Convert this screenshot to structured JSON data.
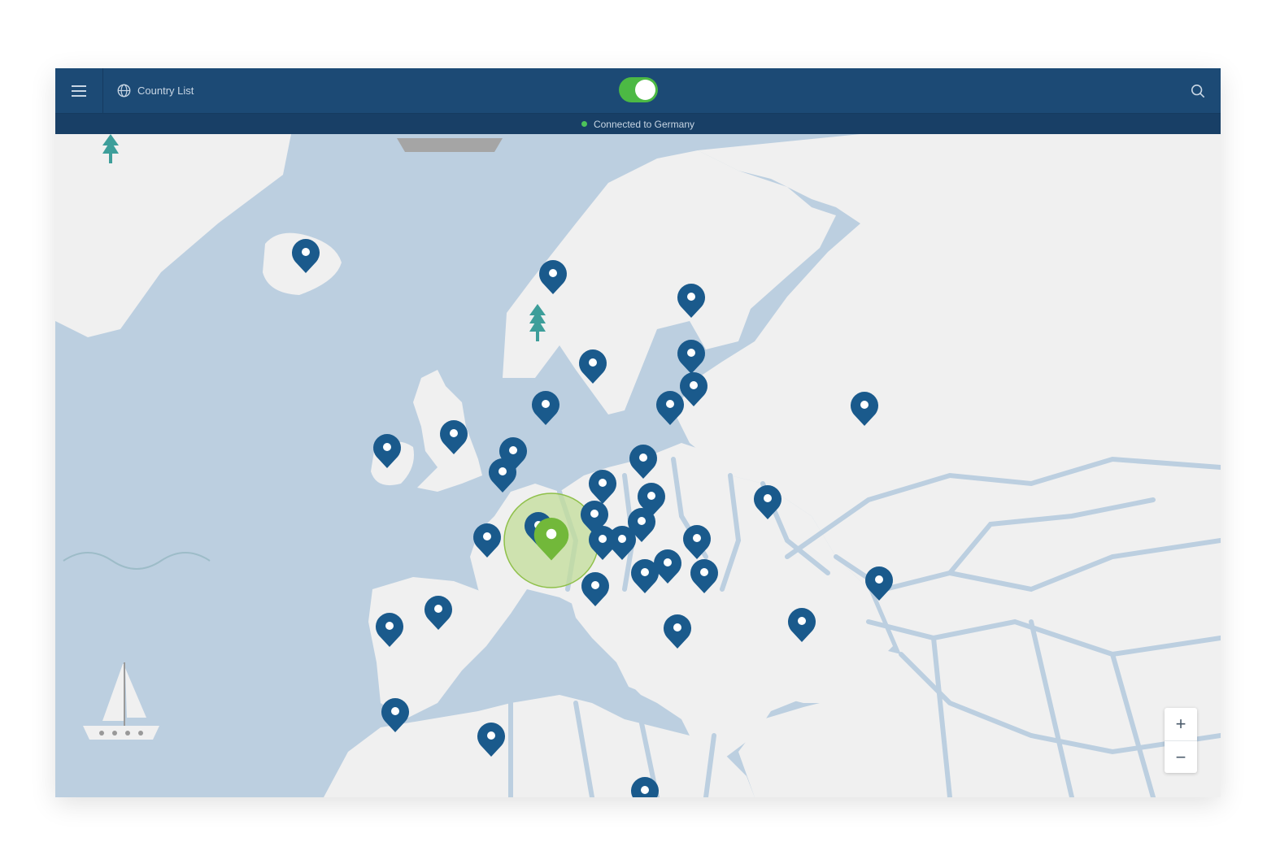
{
  "header": {
    "menu_icon": "hamburger-menu-icon",
    "country_list_label": "Country List",
    "country_list_icon": "globe-icon",
    "search_icon": "search-icon",
    "vpn_toggle_on": true
  },
  "status": {
    "text": "Connected to Germany",
    "dot_color": "#4cc35a"
  },
  "map": {
    "active_country": "Germany",
    "colors": {
      "water": "#bccfe0",
      "land": "#f0f0f0",
      "pin": "#1a5a8c",
      "active_pin": "#72b83a"
    }
  },
  "zoom": {
    "in_label": "+",
    "out_label": "−"
  }
}
